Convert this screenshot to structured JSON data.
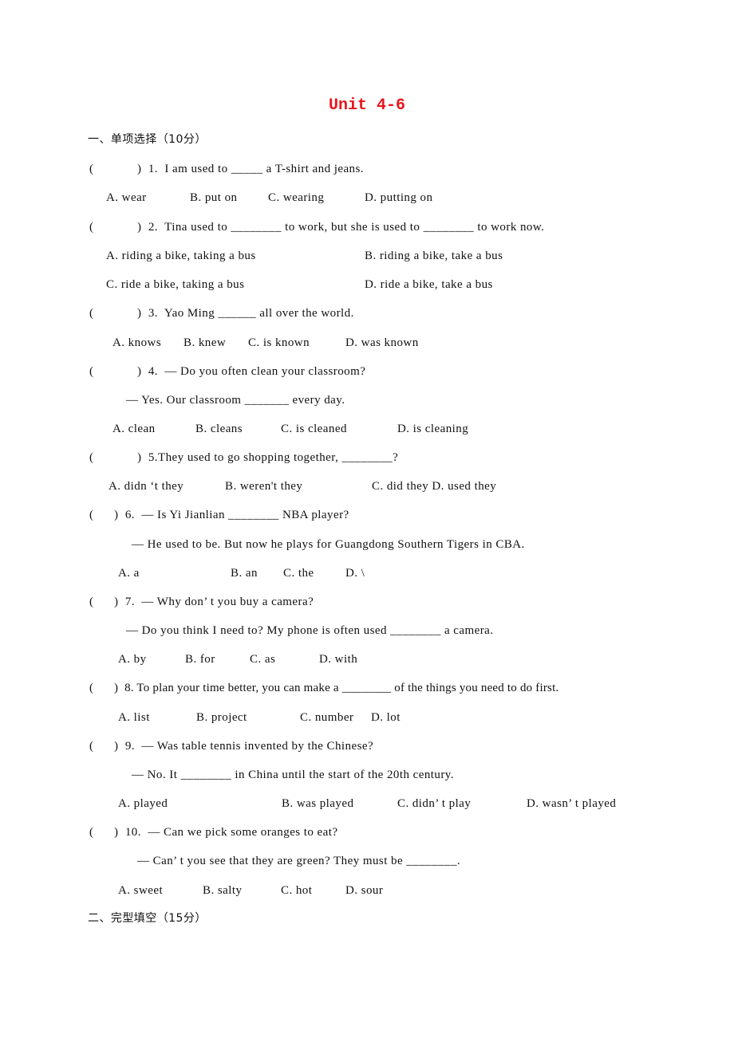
{
  "title": "Unit 4-6",
  "section1": "一、单项选择（10分）",
  "section2": "二、完型填空（15分）",
  "paren_open": "(",
  "questions": [
    {
      "stem": ")  1.  I am used to _____ a T-shirt and jeans.",
      "options": [
        "A. wear",
        "B. put on",
        "C. wearing",
        "D. putting on"
      ]
    },
    {
      "stem": ")  2.  Tina used to ________ to work, but she is used to ________ to work now.",
      "options": [
        "A. riding a bike, taking a bus",
        "B. riding a bike, take a bus",
        "C. ride a bike, taking a bus",
        "D. ride a bike, take a bus"
      ]
    },
    {
      "stem": ")  3.  Yao Ming ______ all over the world.",
      "options": [
        "A. knows",
        "B. knew",
        "C. is known",
        "D. was known"
      ]
    },
    {
      "stem": ")  4.  — Do you often clean your classroom?",
      "reply": "— Yes. Our classroom _______ every day.",
      "options": [
        "A. clean",
        "B. cleans",
        "C. is cleaned",
        "D. is cleaning"
      ]
    },
    {
      "stem": ")  5.They used to go shopping together, ________?",
      "options": [
        "A. didn ‘t they",
        "B. weren't they",
        "C. did they D. used they"
      ]
    },
    {
      "stem": ")  6.  — Is Yi Jianlian ________ NBA player?",
      "reply": "— He used to be. But now he plays for Guangdong Southern Tigers in CBA.",
      "options": [
        "A. a",
        "B. an",
        "C. the",
        "D. \\"
      ]
    },
    {
      "stem": ")  7.  — Why don’ t you buy a camera?",
      "reply": "— Do you think I need to? My phone is often used ________ a camera.",
      "options": [
        "A. by",
        "B. for",
        "C. as",
        "D. with"
      ]
    },
    {
      "stem": ")  8. To plan your time better, you can make a ________ of the things you need to do first.",
      "options": [
        "A. list",
        "B. project",
        "C. number",
        "D. lot"
      ]
    },
    {
      "stem": ")  9.  — Was table tennis invented by the Chinese?",
      "reply": "— No. It ________ in China until the start of the 20th century.",
      "options": [
        "A. played",
        "B. was played",
        "C. didn’ t play",
        "D. wasn’ t played"
      ]
    },
    {
      "stem": ")  10.  — Can we pick some oranges to eat?",
      "reply": "— Can’ t you see that they are green? They must be ________.",
      "options": [
        "A. sweet",
        "B. salty",
        "C. hot",
        "D. sour"
      ]
    }
  ]
}
